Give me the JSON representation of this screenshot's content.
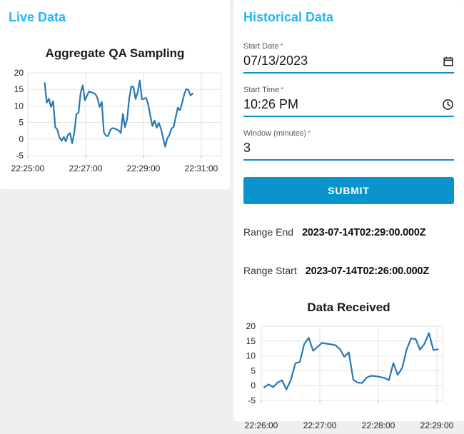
{
  "colors": {
    "panel_heading": "#2ab4f1",
    "primary_button": "#0994ce",
    "input_underline": "#0a8fc8",
    "chart_line": "#2878b4",
    "page_background": "#efefef"
  },
  "live_panel": {
    "heading": "Live Data"
  },
  "historical_panel": {
    "heading": "Historical Data",
    "form": {
      "required_marker": "*",
      "fields": [
        {
          "label": "Start Date",
          "value": "07/13/2023",
          "icon": "calendar-icon"
        },
        {
          "label": "Start Time",
          "value": "10:26 PM",
          "icon": "clock-icon"
        },
        {
          "label": "Window (minutes)",
          "value": "3",
          "icon": null
        }
      ],
      "submit_label": "SUBMIT"
    },
    "results": {
      "range_end_label": "Range End",
      "range_end_value": "2023-07-14T02:29:00.000Z",
      "range_start_label": "Range Start",
      "range_start_value": "2023-07-14T02:26:00.000Z"
    }
  },
  "chart_data": [
    {
      "type": "line",
      "title": "Aggregate QA Sampling",
      "xlabel": "",
      "ylabel": "",
      "ylim": [
        -5,
        20
      ],
      "y_ticks": [
        20,
        15,
        10,
        5,
        0,
        -5
      ],
      "x_span_s": 360,
      "x_ticks": [
        {
          "label": "22:25:00",
          "s": 0
        },
        {
          "label": "22:27:00",
          "s": 120
        },
        {
          "label": "22:29:00",
          "s": 240
        },
        {
          "label": "22:31:00",
          "s": 360
        }
      ],
      "grid": true,
      "legend": "none",
      "line_color": "#2878b4",
      "series": [
        {
          "name": "aggregate-qa-sampling",
          "t_start_s": 35,
          "t_end_s": 342,
          "values": [
            16.9,
            11.0,
            12.2,
            9.7,
            11.4,
            3.6,
            2.8,
            0.5,
            -0.5,
            0.6,
            -0.7,
            1.2,
            1.8,
            -1.3,
            2.0,
            7.5,
            8.0,
            14.0,
            16.2,
            11.7,
            13.1,
            14.4,
            14.1,
            13.9,
            13.6,
            12.3,
            9.7,
            11.2,
            2.0,
            1.0,
            0.9,
            2.7,
            3.3,
            3.2,
            2.9,
            2.6,
            1.8,
            7.6,
            3.6,
            6.0,
            12.2,
            15.9,
            15.7,
            12.1,
            14.1,
            17.7,
            12.0,
            12.2,
            12.4,
            10.4,
            7.0,
            3.9,
            5.6,
            3.4,
            4.9,
            3.2,
            0.4,
            -2.3,
            0.2,
            1.2,
            3.2,
            3.6,
            6.7,
            9.5,
            8.7,
            10.8,
            13.5,
            15.1,
            14.8,
            13.2,
            13.7
          ]
        }
      ]
    },
    {
      "type": "line",
      "title": "Data Received",
      "xlabel": "",
      "ylabel": "",
      "ylim": [
        -5,
        20
      ],
      "y_ticks": [
        20,
        15,
        10,
        5,
        0,
        -5
      ],
      "x_span_s": 180,
      "x_ticks": [
        {
          "label": "22:26:00",
          "s": 0
        },
        {
          "label": "22:27:00",
          "s": 60
        },
        {
          "label": "22:28:00",
          "s": 120
        },
        {
          "label": "22:29:00",
          "s": 180
        }
      ],
      "grid": true,
      "legend": "none",
      "line_color": "#2878b4",
      "series": [
        {
          "name": "data-received",
          "t_start_s": 3,
          "t_end_s": 181,
          "values": [
            -0.6,
            0.4,
            -0.5,
            1.0,
            1.8,
            -1.3,
            2.0,
            7.5,
            8.0,
            14.0,
            16.1,
            11.7,
            13.1,
            14.4,
            14.1,
            13.9,
            13.6,
            12.3,
            9.7,
            11.2,
            2.0,
            1.0,
            0.9,
            2.7,
            3.3,
            3.2,
            2.9,
            2.6,
            1.8,
            7.6,
            3.6,
            6.0,
            12.2,
            15.9,
            15.7,
            12.1,
            14.1,
            17.7,
            12.0,
            12.2
          ]
        }
      ]
    }
  ]
}
